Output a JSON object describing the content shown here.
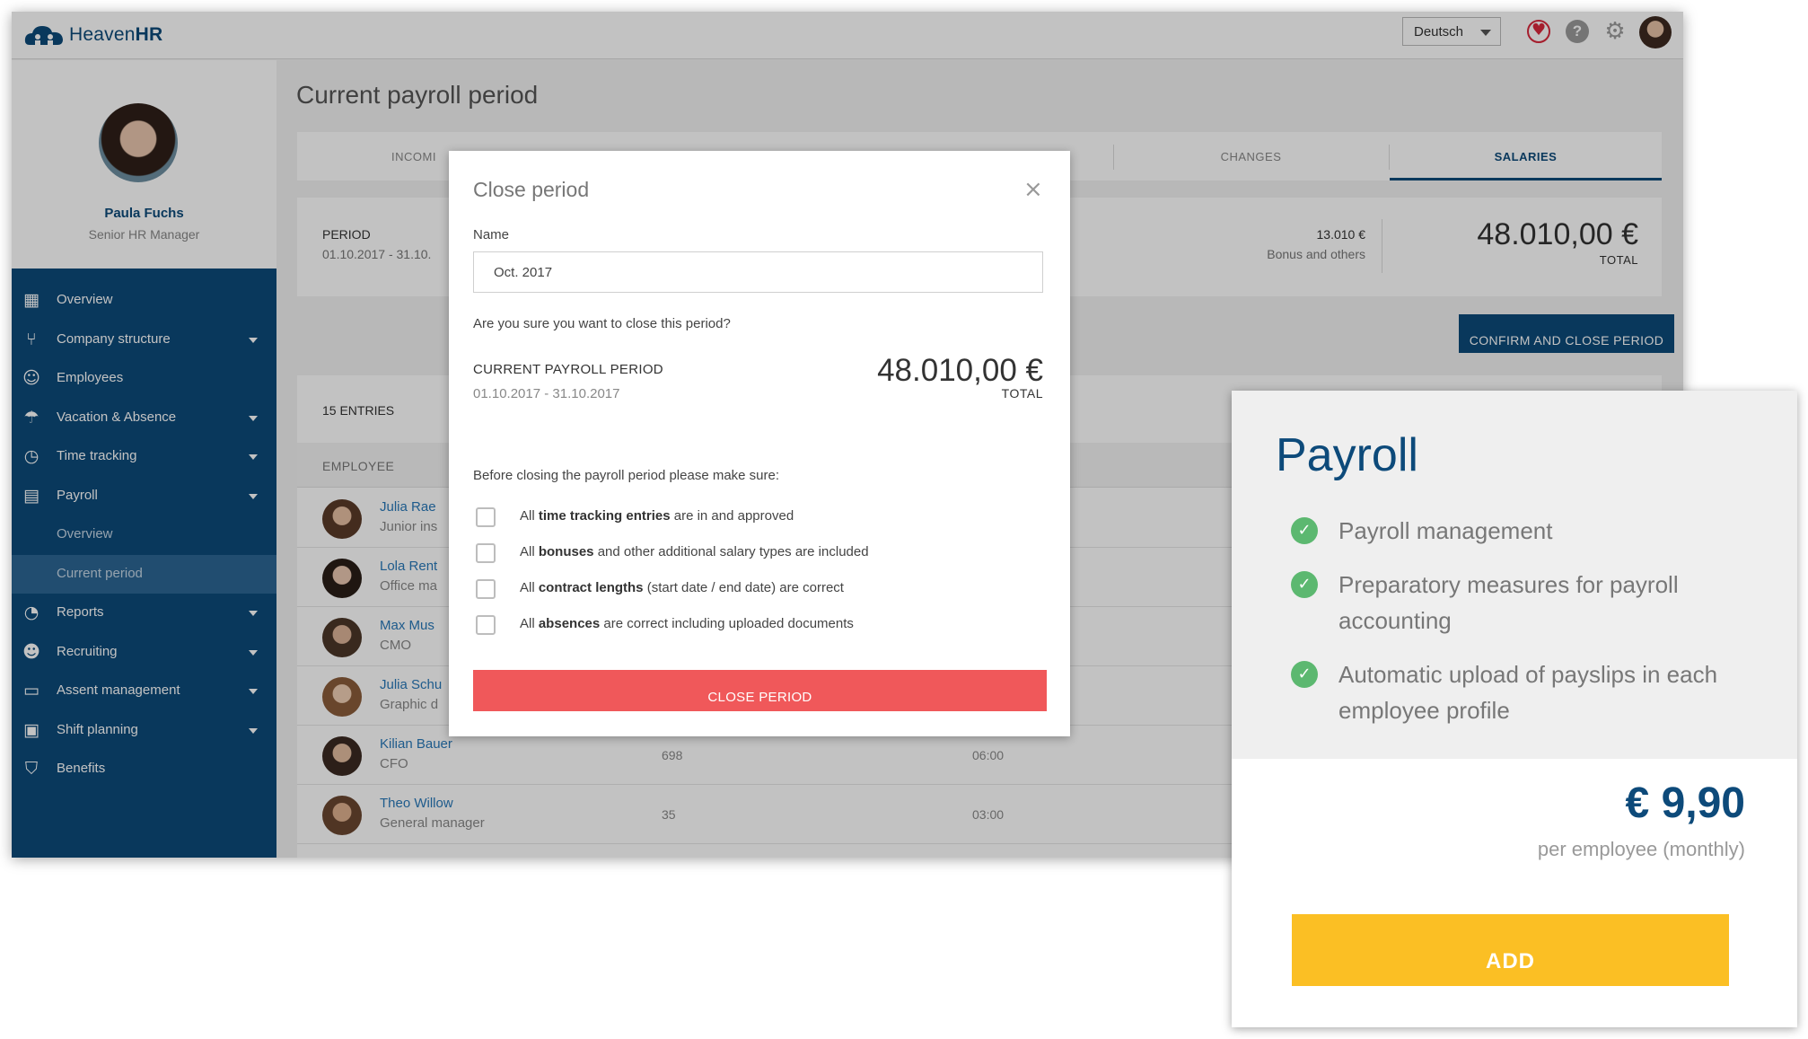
{
  "app": {
    "logo_text": "Heaven",
    "logo_text_bold": "HR",
    "language": "Deutsch",
    "help_glyph": "?",
    "gear_glyph": "⚙"
  },
  "profile": {
    "name": "Paula Fuchs",
    "role": "Senior HR Manager"
  },
  "nav": [
    {
      "label": "Overview",
      "icon": "dashboard-icon",
      "glyph": "▦",
      "caret": false
    },
    {
      "label": "Company structure",
      "icon": "org-chart-icon",
      "glyph": "⑂",
      "caret": true
    },
    {
      "label": "Employees",
      "icon": "people-icon",
      "glyph": "☺",
      "caret": false
    },
    {
      "label": "Vacation & Absence",
      "icon": "umbrella-icon",
      "glyph": "☂",
      "caret": true
    },
    {
      "label": "Time tracking",
      "icon": "stopwatch-icon",
      "glyph": "◷",
      "caret": true
    },
    {
      "label": "Payroll",
      "icon": "wallet-icon",
      "glyph": "▤",
      "caret": true
    },
    {
      "label": "Overview",
      "icon": "",
      "glyph": "",
      "caret": false,
      "sub": true
    },
    {
      "label": "Current period",
      "icon": "",
      "glyph": "",
      "caret": false,
      "sub": true,
      "active": true
    },
    {
      "label": "Reports",
      "icon": "pie-chart-icon",
      "glyph": "◔",
      "caret": true
    },
    {
      "label": "Recruiting",
      "icon": "recruiting-icon",
      "glyph": "☻",
      "caret": true
    },
    {
      "label": "Assent management",
      "icon": "monitor-icon",
      "glyph": "▭",
      "caret": true
    },
    {
      "label": "Shift planning",
      "icon": "calendar-icon",
      "glyph": "▣",
      "caret": true
    },
    {
      "label": "Benefits",
      "icon": "shield-icon",
      "glyph": "⛉",
      "caret": false
    }
  ],
  "main": {
    "title": "Current payroll period",
    "tabs": [
      {
        "label": "INCOMI"
      },
      {
        "label": "CHANGES"
      },
      {
        "label": "SALARIES"
      }
    ],
    "summary": {
      "period_label": "PERIOD",
      "period_value": "01.10.2017 - 31.10.",
      "bonus_value": "13.010 €",
      "bonus_label": "Bonus and others",
      "total": "48.010,00 €",
      "total_label": "TOTAL"
    },
    "confirm_button": "CONFIRM AND CLOSE PERIOD",
    "entries": {
      "title": "15 ENTRIES",
      "column_employee": "EMPLOYEE",
      "rows": [
        {
          "name": "Julia Rae",
          "title": "Junior ins",
          "v1": "",
          "v2": ""
        },
        {
          "name": "Lola Rent",
          "title": "Office ma",
          "v1": "",
          "v2": ""
        },
        {
          "name": "Max Mus",
          "title": "CMO",
          "v1": "",
          "v2": ""
        },
        {
          "name": "Julia Schu",
          "title": "Graphic d",
          "v1": "",
          "v2": ""
        },
        {
          "name": "Kilian Bauer",
          "title": "CFO",
          "v1": "698",
          "v2": "06:00"
        },
        {
          "name": "Theo Willow",
          "title": "General manager",
          "v1": "35",
          "v2": "03:00"
        }
      ]
    }
  },
  "modal": {
    "title": "Close period",
    "close_glyph": "×",
    "name_label": "Name",
    "name_value": "Oct. 2017",
    "question": "Are you sure you want to close this period?",
    "cpp_label": "CURRENT PAYROLL PERIOD",
    "cpp_range": "01.10.2017 -  31.10.2017",
    "total": "48.010,00 €",
    "total_label": "TOTAL",
    "before_label": "Before closing the payroll period please make sure:",
    "checks": [
      {
        "pre": "All ",
        "bold": "time tracking entries",
        "post": " are in and approved"
      },
      {
        "pre": "All ",
        "bold": "bonuses",
        "post": " and other additional salary types are included"
      },
      {
        "pre": "All ",
        "bold": "contract lengths",
        "post": " (start date / end date) are correct"
      },
      {
        "pre": "All ",
        "bold": "absences",
        "post": " are correct including uploaded documents"
      }
    ],
    "close_button": "CLOSE PERIOD"
  },
  "card": {
    "title": "Payroll",
    "features": [
      "Payroll management",
      "Preparatory measures for payroll accounting",
      "Automatic upload of payslips in each employee profile"
    ],
    "check_glyph": "✓",
    "price": "€ 9,90",
    "price_sub": "per employee (monthly)",
    "add_button": "ADD"
  }
}
